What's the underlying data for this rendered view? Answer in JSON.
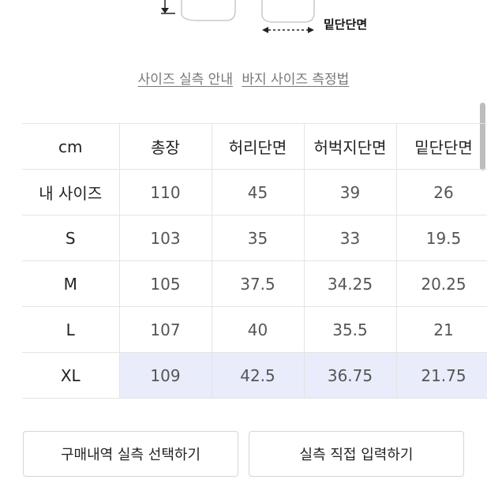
{
  "illustration": {
    "label": "밑단단면"
  },
  "links": {
    "size_guide": "사이즈 실측 안내",
    "pants_measure": "바지 사이즈 측정법"
  },
  "table": {
    "headers": [
      "cm",
      "총장",
      "허리단면",
      "허벅지단면",
      "밑단단면"
    ],
    "rows": [
      {
        "label": "내 사이즈",
        "values": [
          "110",
          "45",
          "39",
          "26"
        ]
      },
      {
        "label": "S",
        "values": [
          "103",
          "35",
          "33",
          "19.5"
        ]
      },
      {
        "label": "M",
        "values": [
          "105",
          "37.5",
          "34.25",
          "20.25"
        ]
      },
      {
        "label": "L",
        "values": [
          "107",
          "40",
          "35.5",
          "21"
        ]
      },
      {
        "label": "XL",
        "values": [
          "109",
          "42.5",
          "36.75",
          "21.75"
        ]
      }
    ],
    "selected_row": "XL",
    "highlight_color": "#e8ecfb"
  },
  "buttons": {
    "purchase_history": "구매내역 실측 선택하기",
    "manual_input": "실측 직접 입력하기"
  }
}
